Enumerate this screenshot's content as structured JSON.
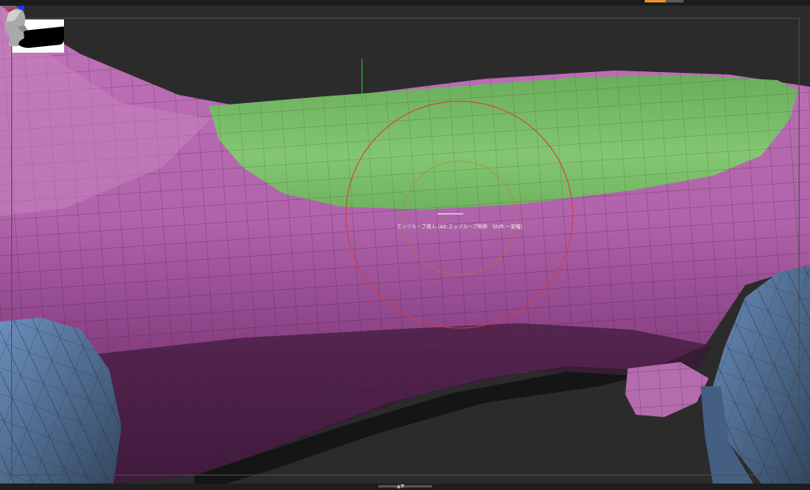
{
  "viewport": {
    "tooltip": "エッジループ挿入 (Alt:エッジループ削除　Shift:一変幅)",
    "thumbnail": "navigation-thumbnail",
    "gizmo": "axis-gizmo",
    "orientation_head": "head-orientation-icon"
  },
  "colors": {
    "background": "#2b2b2b",
    "mesh_pink": "#b164ab",
    "mesh_pink_shadow": "#6a2f66",
    "mesh_green": "#7dc46c",
    "mesh_blue": "#5d7fa8",
    "brush_circle": "#d03232",
    "accent": "#e89422"
  },
  "bottombar": {
    "grip_label": "▲▼"
  }
}
